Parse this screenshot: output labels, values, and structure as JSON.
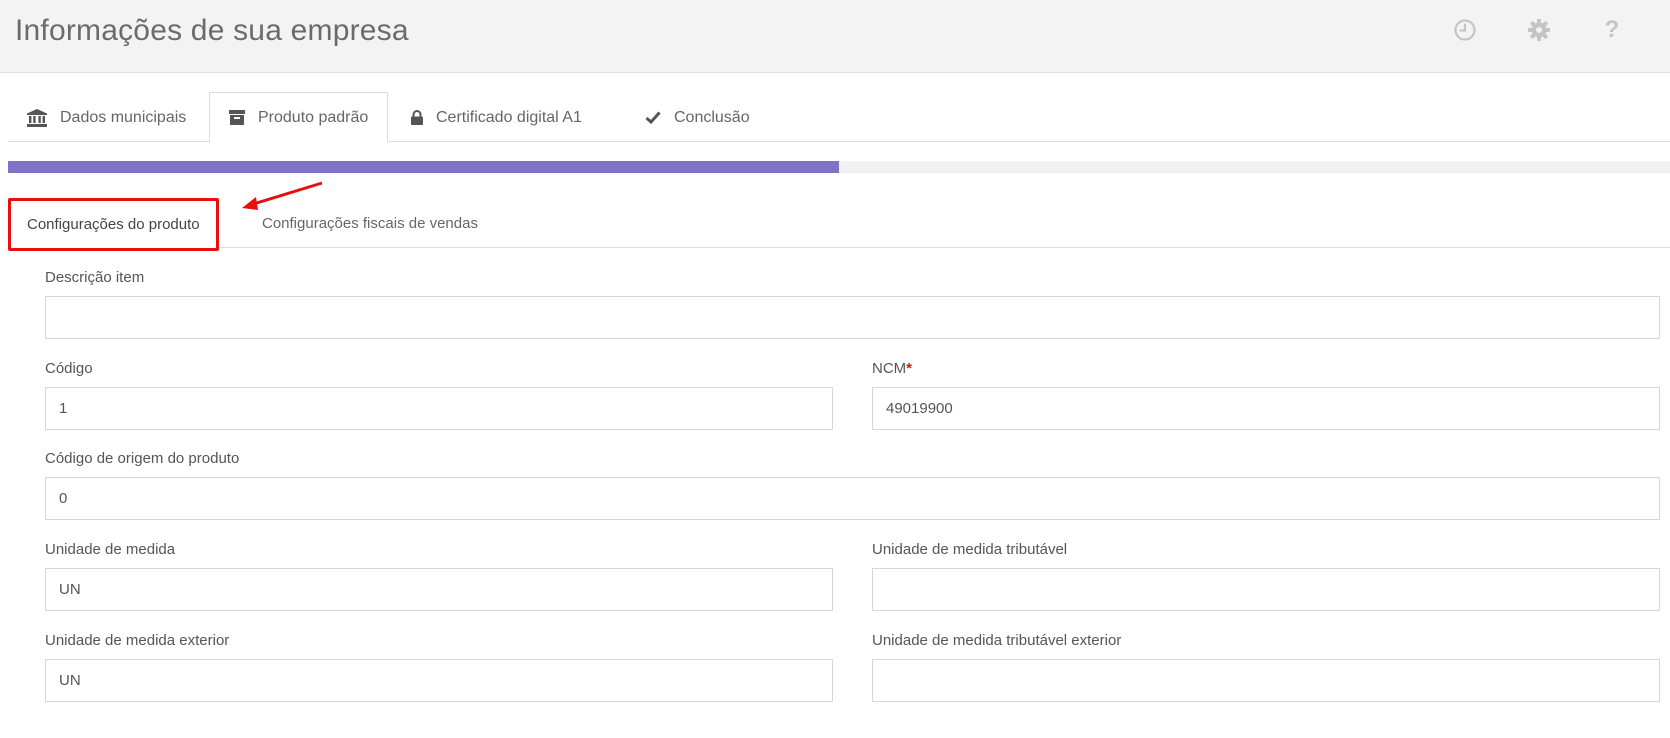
{
  "header": {
    "title": "Informações de sua empresa",
    "icons": [
      "clock-icon",
      "gear-icon",
      "help-icon"
    ],
    "help_glyph": "?"
  },
  "steps": [
    {
      "label": "Dados municipais",
      "icon": "bank-icon",
      "active": false
    },
    {
      "label": "Produto padrão",
      "icon": "archive-icon",
      "active": true
    },
    {
      "label": "Certificado digital A1",
      "icon": "lock-icon",
      "active": false
    },
    {
      "label": "Conclusão",
      "icon": "check-icon",
      "active": false
    }
  ],
  "progress": {
    "fraction": 0.5,
    "color": "#7f74c4"
  },
  "subtabs": [
    {
      "label": "Configurações do produto",
      "active": true,
      "highlight_color": "#e80f0f"
    },
    {
      "label": "Configurações fiscais de vendas",
      "active": false
    }
  ],
  "form": {
    "descricao": {
      "label": "Descrição item",
      "value": ""
    },
    "codigo": {
      "label": "Código",
      "value": "1"
    },
    "ncm": {
      "label": "NCM",
      "required_mark": "*",
      "value": "49019900"
    },
    "origem": {
      "label": "Código de origem do produto",
      "value": "0"
    },
    "unidade": {
      "label": "Unidade de medida",
      "value": "UN"
    },
    "unidade_trib": {
      "label": "Unidade de medida tributável",
      "value": ""
    },
    "unidade_ext": {
      "label": "Unidade de medida exterior",
      "value": "UN"
    },
    "unidade_trib_ext": {
      "label": "Unidade de medida tributável exterior",
      "value": ""
    }
  }
}
